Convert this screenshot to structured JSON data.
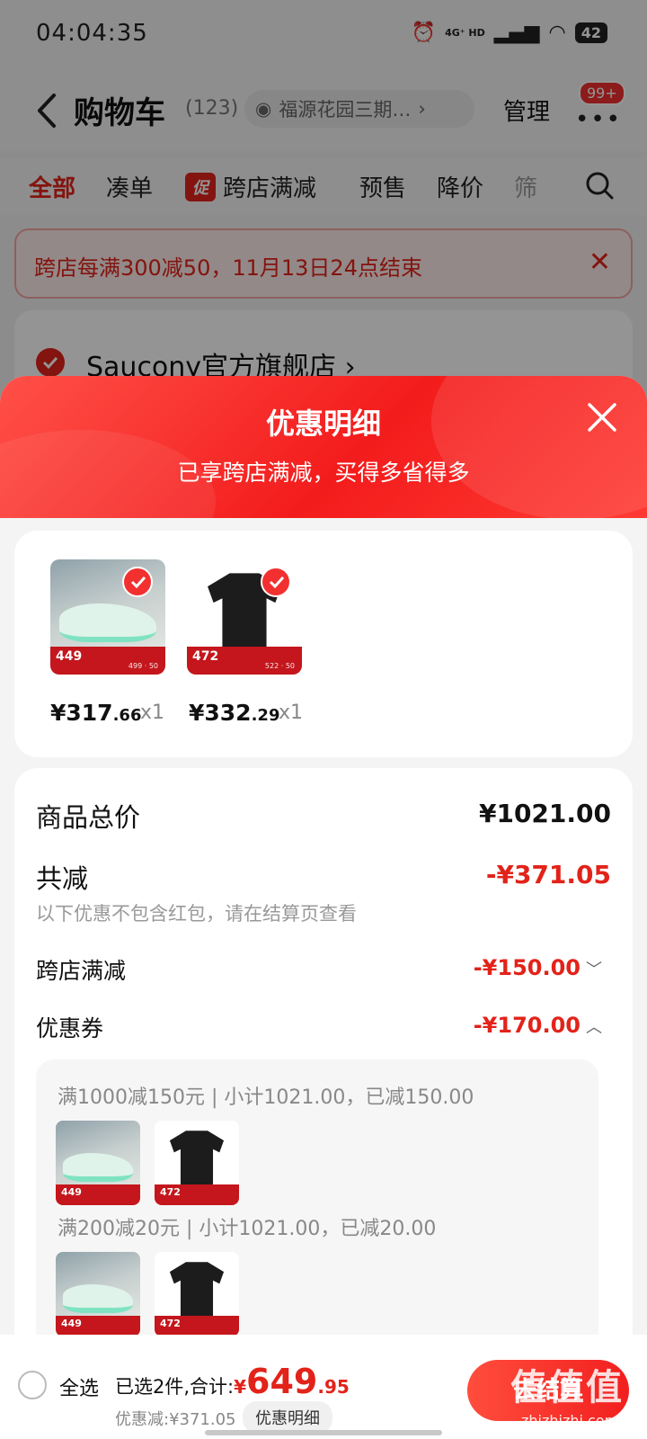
{
  "status_bar": {
    "time": "04:04:35",
    "network": "4G⁺ HD",
    "battery": "42"
  },
  "header": {
    "title": "购物车",
    "count": "(123)",
    "address": "福源花园三期…",
    "manage_label": "管理",
    "badge": "99+"
  },
  "tabs": [
    "全部",
    "凑单",
    "跨店满减",
    "预售",
    "降价",
    "筛"
  ],
  "promo_tag": "促",
  "notice": {
    "text": "跨店每满300减50，11月13日24点结束"
  },
  "store": {
    "name": "Saucony官方旗舰店 ›"
  },
  "sheet": {
    "title": "优惠明细",
    "subtitle": "已享跨店满减，买得多省得多"
  },
  "products": [
    {
      "thumb_price": "449",
      "price_int": "¥317",
      "price_dec": ".66",
      "qty": "x1",
      "image": "shoe",
      "thumb_sub": "499 · 50"
    },
    {
      "thumb_price": "472",
      "price_int": "¥332",
      "price_dec": ".29",
      "qty": "x1",
      "image": "shirt",
      "thumb_sub": "522 · 50"
    }
  ],
  "summary": {
    "total_label": "商品总价",
    "total_value": "¥1021.00",
    "reduce_label": "共减",
    "reduce_value": "-¥371.05",
    "reduce_note": "以下优惠不包含红包，请在结算页查看",
    "cross_store_label": "跨店满减",
    "cross_store_value": "-¥150.00",
    "coupon_label": "优惠券",
    "coupon_value": "-¥170.00"
  },
  "coupon_details": [
    {
      "text": "满1000减150元 | 小计1021.00，已减150.00"
    },
    {
      "text": "满200减20元 | 小计1021.00，已减20.00"
    }
  ],
  "bottom_bar": {
    "select_all": "全选",
    "selected_text": "已选2件,合计:",
    "currency": "¥",
    "total_int": "649",
    "total_dec": ".95",
    "discount_text": "优惠减:¥371.05",
    "detail_button": "优惠明细",
    "checkout": "去结算"
  },
  "watermark": {
    "logo": "值值值",
    "url": "zhizhizhi.com"
  },
  "colors": {
    "accent": "#e2231a",
    "sheet_header": "#f31c1c",
    "price_tag": "#c4161c"
  }
}
